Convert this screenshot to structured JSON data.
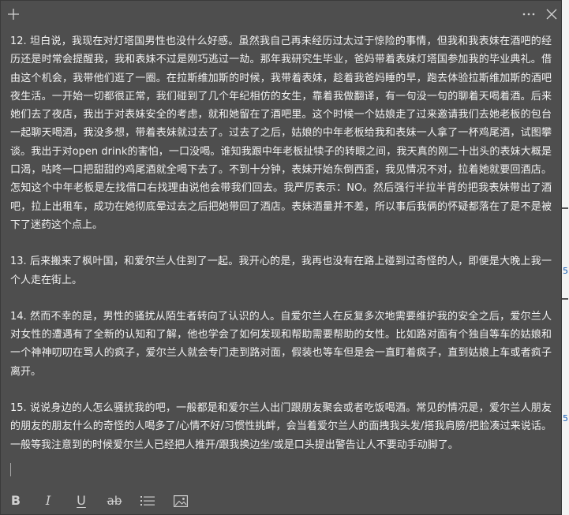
{
  "window": {
    "colors": {
      "background": "#4e4e4e",
      "text": "#f2f2f2",
      "icon": "#cfcfcf"
    },
    "icons": {
      "new_note": "plus-icon",
      "menu": "more-options-icon",
      "close": "close-icon"
    }
  },
  "notes": [
    {
      "text": "12. 坦白说，我现在对灯塔国男性也没什么好感。虽然我自己再未经历过太过于惊险的事情，但我和我表妹在酒吧的经历还是时常会提醒我，我和表妹不过是刚巧逃过一劫。那年我研究生毕业，爸妈带着表妹灯塔国参加我的毕业典礼。借由这个机会，我带他们逛了一圈。在拉斯维加斯的时候，我带着表妹，趁着我爸妈睡的早，跑去体验拉斯维加斯的酒吧夜生活。一开始一切都很正常，我们碰到了几个年纪相仿的女生，靠着我做翻译，有一句没一句的聊着天喝着酒。后来她们去了夜店，我出于对表妹安全的考虑，就和她留在了酒吧里。这个时候一个姑娘走了过来邀请我们去她老板的包台一起聊天喝酒，我没多想，带着表妹就过去了。过去了之后，姑娘的中年老板给我和表妹一人拿了一杯鸡尾酒，试图攀谈。我出于对open drink的害怕，一口没喝。谁知我跟中年老板扯犊子的转眼之间，我天真的刚二十出头的表妹大概是口渴，咕咚一口把甜甜的鸡尾酒就全喝下去了。不到十分钟，表妹开始东倒西歪，我见情况不对，拉着她就要回酒店。怎知这个中年老板是左找借口右找理由说他会带我们回去。我严厉表示：NO。然后强行半拉半背的把我表妹带出了酒吧，拉上出租车，成功在她彻底晕过去之后把她带回了酒店。表妹酒量并不差，所以事后我俩的怀疑都落在了是不是被下了迷药这个点上。"
    },
    {
      "text": "13. 后来搬来了枫叶国，和爱尔兰人住到了一起。我开心的是，我再也没有在路上碰到过奇怪的人，即便是大晚上我一个人走在街上。"
    },
    {
      "text": "14. 然而不幸的是，男性的骚扰从陌生者转向了认识的人。自爱尔兰人在反复多次地需要维护我的安全之后，爱尔兰人对女性的遭遇有了全新的认知和了解，他也学会了如何发现和帮助需要帮助的女性。比如路对面有个独自等车的姑娘和一个神神叨叨在骂人的疯子，爱尔兰人就会专门走到路对面，假装也等车但是会一直盯着疯子，直到姑娘上车或者疯子离开。"
    },
    {
      "text": "15. 说说身边的人怎么骚扰我的吧，一般都是和爱尔兰人出门跟朋友聚会或者吃饭喝酒。常见的情况是，爱尔兰人朋友的朋友的朋友什么的奇怪的人喝多了/心情不好/习惯性挑衅，会当着爱尔兰人的面拽我头发/搭我肩膀/把脸凑过来说话。一般等我注意到的时候爱尔兰人已经把人推开/跟我换边坐/或是口头提出警告让人不要动手动脚了。"
    }
  ],
  "toolbar": {
    "bold": {
      "label": "B",
      "icon": "bold-icon"
    },
    "italic": {
      "label": "I",
      "icon": "italic-icon"
    },
    "underline": {
      "label": "U",
      "icon": "underline-icon"
    },
    "strikethrough": {
      "label": "ab",
      "icon": "strikethrough-icon"
    },
    "list": {
      "icon": "bulleted-list-icon"
    },
    "image": {
      "icon": "image-icon"
    }
  }
}
